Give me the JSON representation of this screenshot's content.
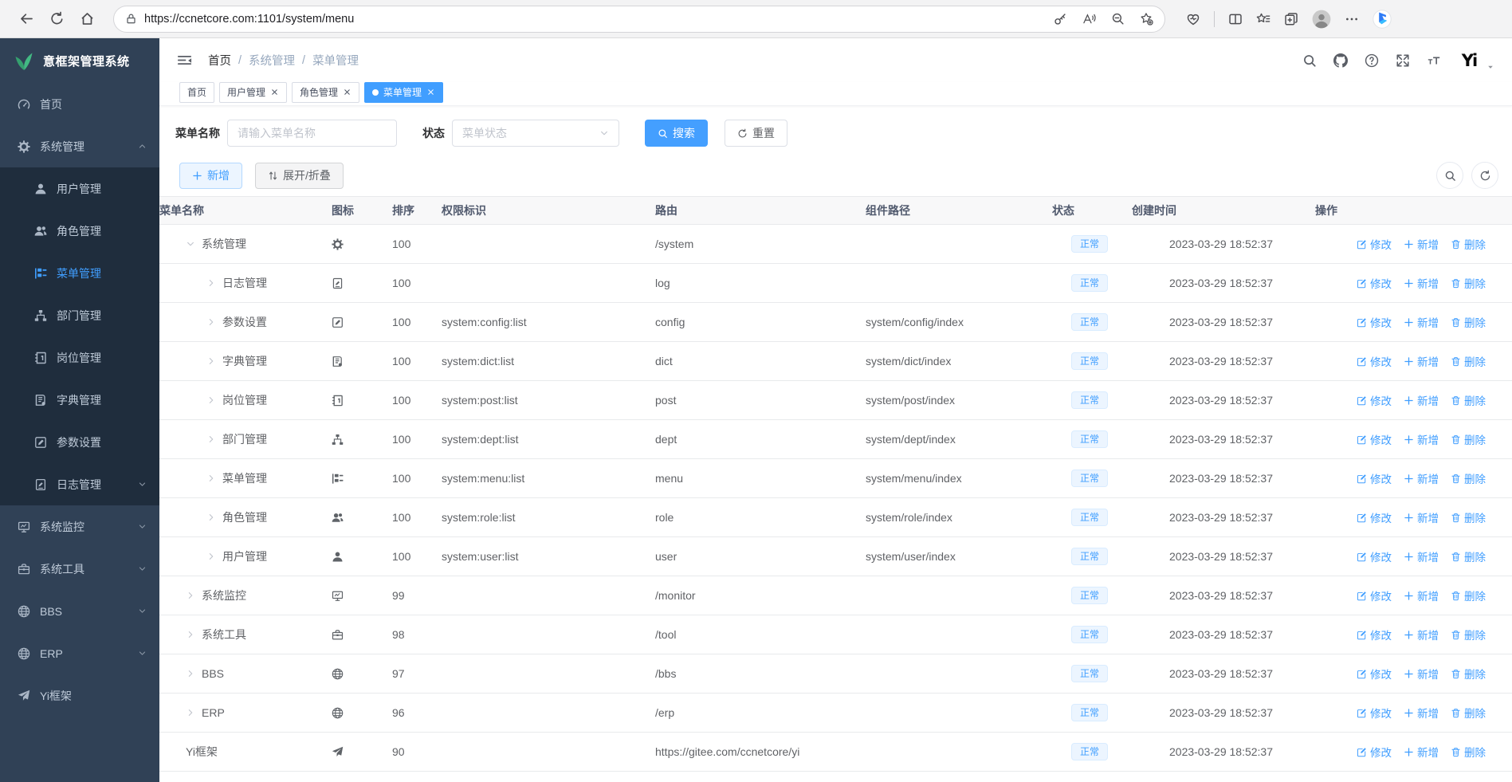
{
  "colors": {
    "primary": "#409eff",
    "sidebar_bg": "#304156",
    "sidebar_submenu_bg": "#1f2d3d",
    "badge_bg": "#ecf5ff",
    "badge_text": "#409eff"
  },
  "browser": {
    "url": "https://ccnetcore.com:1101/system/menu",
    "left_icons": [
      {
        "name": "back-icon"
      },
      {
        "name": "reload-icon"
      },
      {
        "name": "home-icon"
      }
    ],
    "pill_right_icons": [
      {
        "name": "key-icon"
      },
      {
        "name": "read-aloud-icon"
      },
      {
        "name": "zoom-out-icon"
      },
      {
        "name": "add-favorite-icon"
      }
    ],
    "right_icons": [
      {
        "name": "browser-essentials-icon",
        "divider_after": true
      },
      {
        "name": "split-screen-icon"
      },
      {
        "name": "favorites-icon"
      },
      {
        "name": "collections-icon"
      },
      {
        "name": "profile-icon"
      },
      {
        "name": "more-icon"
      },
      {
        "name": "bing-icon"
      }
    ]
  },
  "app": {
    "logo": {
      "title": "意框架管理系统",
      "icon": "leaf-icon"
    },
    "sidebar": {
      "items": [
        {
          "label": "首页",
          "icon": "dashboard-icon",
          "level": "1"
        },
        {
          "label": "系统管理",
          "icon": "gear-icon",
          "level": "1",
          "arrow_icon": "chevron-up-icon",
          "state": "open"
        },
        {
          "label": "用户管理",
          "icon": "user-icon",
          "level": "2"
        },
        {
          "label": "角色管理",
          "icon": "users-icon",
          "level": "2"
        },
        {
          "label": "菜单管理",
          "icon": "menu-tree-icon",
          "level": "2",
          "state": "active"
        },
        {
          "label": "部门管理",
          "icon": "org-tree-icon",
          "level": "2"
        },
        {
          "label": "岗位管理",
          "icon": "badge-icon",
          "level": "2"
        },
        {
          "label": "字典管理",
          "icon": "book-icon",
          "level": "2"
        },
        {
          "label": "参数设置",
          "icon": "edit-icon",
          "level": "2"
        },
        {
          "label": "日志管理",
          "icon": "log-icon",
          "level": "2",
          "arrow_icon": "chevron-down-icon"
        },
        {
          "label": "系统监控",
          "icon": "monitor-icon",
          "level": "1",
          "arrow_icon": "chevron-down-icon"
        },
        {
          "label": "系统工具",
          "icon": "toolbox-icon",
          "level": "1",
          "arrow_icon": "chevron-down-icon"
        },
        {
          "label": "BBS",
          "icon": "globe-icon",
          "level": "1",
          "arrow_icon": "chevron-down-icon"
        },
        {
          "label": "ERP",
          "icon": "globe-icon",
          "level": "1",
          "arrow_icon": "chevron-down-icon"
        },
        {
          "label": "Yi框架",
          "icon": "paper-plane-icon",
          "level": "1"
        }
      ]
    },
    "navbar": {
      "breadcrumb": {
        "separator": "/",
        "items": [
          {
            "label": "首页",
            "tone": "dark"
          },
          {
            "label": "系统管理",
            "sep": true
          },
          {
            "label": "菜单管理",
            "sep": true
          }
        ]
      },
      "right_icons": [
        {
          "name": "search-icon"
        },
        {
          "name": "github-icon"
        },
        {
          "name": "question-icon"
        },
        {
          "name": "fullscreen-icon"
        },
        {
          "name": "font-size-icon"
        }
      ],
      "avatar_text": "Yi"
    },
    "tabs": {
      "items": [
        {
          "label": "首页",
          "closable": false
        },
        {
          "label": "用户管理",
          "closable": true
        },
        {
          "label": "角色管理",
          "closable": true
        },
        {
          "label": "菜单管理",
          "closable": true,
          "dot": true,
          "state": "active"
        }
      ]
    },
    "filter": {
      "name_label": "菜单名称",
      "name_placeholder": "请输入菜单名称",
      "status_label": "状态",
      "status_placeholder": "菜单状态",
      "search_label": "搜索",
      "reset_label": "重置"
    },
    "toolbar": {
      "add_label": "新增",
      "toggle_label": "展开/折叠"
    },
    "table": {
      "columns": [
        {
          "label": "菜单名称"
        },
        {
          "label": "图标"
        },
        {
          "label": "排序"
        },
        {
          "label": "权限标识"
        },
        {
          "label": "路由"
        },
        {
          "label": "组件路径"
        },
        {
          "label": "状态"
        },
        {
          "label": "创建时间"
        },
        {
          "label": "操作"
        }
      ],
      "actions": {
        "edit": "修改",
        "add": "新增",
        "delete": "删除"
      },
      "rows": [
        {
          "name": "系统管理",
          "arrow_icon": "chevron-down-icon",
          "level": "1",
          "icon": "gear-icon",
          "order": "100",
          "perm": "",
          "route": "/system",
          "component": "",
          "status": "正常",
          "created": "2023-03-29 18:52:37"
        },
        {
          "name": "日志管理",
          "arrow_icon": "chevron-right-icon",
          "level": "2",
          "icon": "log-icon",
          "order": "100",
          "perm": "",
          "route": "log",
          "component": "",
          "status": "正常",
          "created": "2023-03-29 18:52:37"
        },
        {
          "name": "参数设置",
          "arrow_icon": "chevron-right-icon",
          "level": "2",
          "icon": "edit-icon",
          "order": "100",
          "perm": "system:config:list",
          "route": "config",
          "component": "system/config/index",
          "status": "正常",
          "created": "2023-03-29 18:52:37"
        },
        {
          "name": "字典管理",
          "arrow_icon": "chevron-right-icon",
          "level": "2",
          "icon": "book-icon",
          "order": "100",
          "perm": "system:dict:list",
          "route": "dict",
          "component": "system/dict/index",
          "status": "正常",
          "created": "2023-03-29 18:52:37"
        },
        {
          "name": "岗位管理",
          "arrow_icon": "chevron-right-icon",
          "level": "2",
          "icon": "badge-icon",
          "order": "100",
          "perm": "system:post:list",
          "route": "post",
          "component": "system/post/index",
          "status": "正常",
          "created": "2023-03-29 18:52:37"
        },
        {
          "name": "部门管理",
          "arrow_icon": "chevron-right-icon",
          "level": "2",
          "icon": "org-tree-icon",
          "order": "100",
          "perm": "system:dept:list",
          "route": "dept",
          "component": "system/dept/index",
          "status": "正常",
          "created": "2023-03-29 18:52:37"
        },
        {
          "name": "菜单管理",
          "arrow_icon": "chevron-right-icon",
          "level": "2",
          "icon": "menu-tree-icon",
          "order": "100",
          "perm": "system:menu:list",
          "route": "menu",
          "component": "system/menu/index",
          "status": "正常",
          "created": "2023-03-29 18:52:37"
        },
        {
          "name": "角色管理",
          "arrow_icon": "chevron-right-icon",
          "level": "2",
          "icon": "users-icon",
          "order": "100",
          "perm": "system:role:list",
          "route": "role",
          "component": "system/role/index",
          "status": "正常",
          "created": "2023-03-29 18:52:37"
        },
        {
          "name": "用户管理",
          "arrow_icon": "chevron-right-icon",
          "level": "2",
          "icon": "user-icon",
          "order": "100",
          "perm": "system:user:list",
          "route": "user",
          "component": "system/user/index",
          "status": "正常",
          "created": "2023-03-29 18:52:37"
        },
        {
          "name": "系统监控",
          "arrow_icon": "chevron-right-icon",
          "level": "1",
          "icon": "monitor-icon",
          "order": "99",
          "perm": "",
          "route": "/monitor",
          "component": "",
          "status": "正常",
          "created": "2023-03-29 18:52:37"
        },
        {
          "name": "系统工具",
          "arrow_icon": "chevron-right-icon",
          "level": "1",
          "icon": "toolbox-icon",
          "order": "98",
          "perm": "",
          "route": "/tool",
          "component": "",
          "status": "正常",
          "created": "2023-03-29 18:52:37"
        },
        {
          "name": "BBS",
          "arrow_icon": "chevron-right-icon",
          "level": "1",
          "icon": "globe-icon",
          "order": "97",
          "perm": "",
          "route": "/bbs",
          "component": "",
          "status": "正常",
          "created": "2023-03-29 18:52:37"
        },
        {
          "name": "ERP",
          "arrow_icon": "chevron-right-icon",
          "level": "1",
          "icon": "globe-icon",
          "order": "96",
          "perm": "",
          "route": "/erp",
          "component": "",
          "status": "正常",
          "created": "2023-03-29 18:52:37"
        },
        {
          "name": "Yi框架",
          "level": "1",
          "icon": "paper-plane-icon",
          "order": "90",
          "perm": "",
          "route": "https://gitee.com/ccnetcore/yi",
          "component": "",
          "status": "正常",
          "created": "2023-03-29 18:52:37"
        }
      ]
    }
  }
}
